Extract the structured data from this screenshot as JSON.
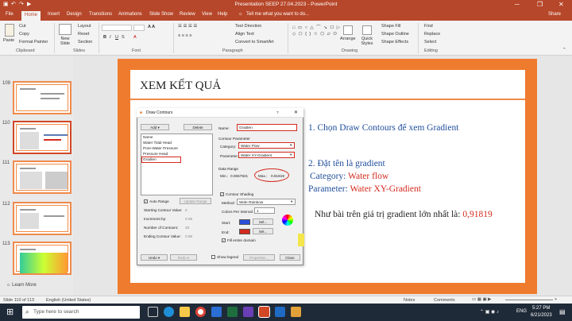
{
  "window": {
    "title": "Presentation SEEP 27.04.2023 - PowerPoint",
    "brand_color": "#b7472a"
  },
  "tabs": [
    "File",
    "Home",
    "Insert",
    "Design",
    "Transitions",
    "Animations",
    "Slide Show",
    "Review",
    "View",
    "Help"
  ],
  "tell_me": "Tell me what you want to do...",
  "share_label": "Share",
  "ribbon": {
    "clipboard": {
      "paste": "Paste",
      "cut": "Cut",
      "copy": "Copy",
      "format_painter": "Format Painter",
      "group": "Clipboard"
    },
    "slides": {
      "new_slide": "New Slide",
      "layout": "Layout",
      "reset": "Reset",
      "section": "Section",
      "group": "Slides"
    },
    "font": {
      "group": "Font"
    },
    "paragraph": {
      "text_direction": "Text Direction",
      "align_text": "Align Text",
      "smartart": "Convert to SmartArt",
      "group": "Paragraph"
    },
    "drawing": {
      "arrange": "Arrange",
      "quick_styles": "Quick Styles",
      "shape_fill": "Shape Fill",
      "shape_outline": "Shape Outline",
      "shape_effects": "Shape Effects",
      "group": "Drawing"
    },
    "editing": {
      "find": "Find",
      "replace": "Replace",
      "select": "Select",
      "group": "Editing"
    }
  },
  "thumbnails": [
    {
      "num": "109"
    },
    {
      "num": "110"
    },
    {
      "num": "111"
    },
    {
      "num": "112"
    },
    {
      "num": "113"
    }
  ],
  "learn_more": "Learn More",
  "slide": {
    "title": "XEM KẾT QUẢ",
    "step1": "1. Chọn Draw Contours để xem Gradient",
    "step2": "2. Đặt tên là gradient",
    "category_label": "Category: ",
    "category_value": "Water flow",
    "parameter_label": "Parameter: ",
    "parameter_value": "Water XY-Gradient",
    "note_prefix": "Như bài trên giá trị gradient lớn nhất là: ",
    "note_value": "0,91819",
    "accent_color": "#ef7b2e",
    "value_color": "#d42a1e",
    "text_color": "#1f4e9c"
  },
  "dialog": {
    "title": "Draw Contours",
    "help": "?",
    "add": "Add",
    "delete": "Delete",
    "list": [
      "Name",
      "Water Total Head",
      "Pore-Water Pressure",
      "Pressure Head",
      "Gradien"
    ],
    "name_label": "Name:",
    "name_value": "Gradien",
    "contour_parameter": "Contour Parameter",
    "category_label": "Category:",
    "category_value": "Water Flow",
    "parameter_label": "Parameter:",
    "parameter_value": "Water XY-Gradient",
    "data_range": "Data Range",
    "min_label": "Min.:",
    "min_value": "0.0667821",
    "max_label": "Max.:",
    "max_value": "0.91819",
    "auto_range": "Auto Range",
    "update_range": "Update Range",
    "starting_label": "Starting Contour Value:",
    "starting_value": "0",
    "increment_label": "Increment by:",
    "increment_value": "0.05",
    "number_label": "Number of Contours:",
    "number_value": "20",
    "ending_label": "Ending Contour Value:",
    "ending_value": "0.95",
    "contour_shading": "Contour Shading",
    "method_label": "Method:",
    "method_value": "Wide Rainbow",
    "colors_label": "Colors Per Interval:",
    "colors_value": "1",
    "start_label": "Start:",
    "end_label": "End:",
    "sel": "Sel...",
    "fill_entire": "Fill entire domain",
    "undo": "Undo",
    "redo": "Redo",
    "show_legend": "Show legend",
    "properties": "Properties...",
    "close": "Close"
  },
  "status": {
    "slide": "Slide 110 of 113",
    "language": "English (United States)",
    "notes": "Notes",
    "comments": "Comments",
    "zoom": "+"
  },
  "taskbar": {
    "search_placeholder": "Type here to search",
    "time": "5:27 PM",
    "date": "6/21/2023",
    "lang": "ENG"
  }
}
